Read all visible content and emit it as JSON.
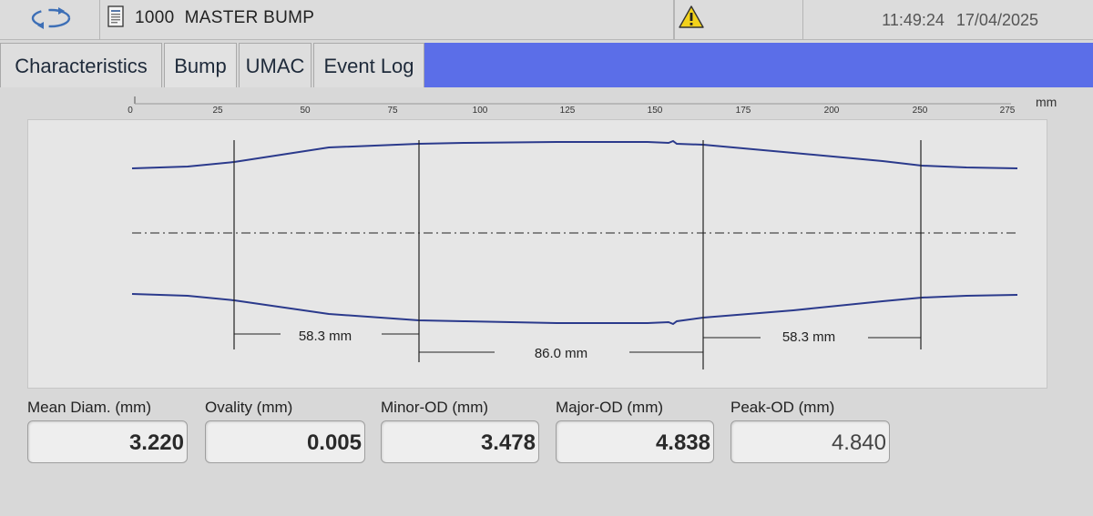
{
  "header": {
    "title": "1000  MASTER BUMP",
    "time": "11:49:24",
    "date": "17/04/2025",
    "icons": {
      "refresh": "refresh-icon",
      "document": "document-icon",
      "warning": "warning-icon"
    }
  },
  "tabs": [
    {
      "label": "Characteristics",
      "active": false
    },
    {
      "label": "Bump",
      "active": true
    },
    {
      "label": "UMAC",
      "active": false
    },
    {
      "label": "Event Log",
      "active": false
    }
  ],
  "ruler": {
    "unit": "mm",
    "ticks": [
      "0",
      "25",
      "50",
      "75",
      "100",
      "125",
      "150",
      "175",
      "200",
      "250",
      "275"
    ]
  },
  "profile": {
    "dimensions": [
      {
        "label": "58.3 mm"
      },
      {
        "label": "86.0 mm"
      },
      {
        "label": "58.3 mm"
      }
    ]
  },
  "readouts": [
    {
      "label": "Mean Diam. (mm)",
      "value": "3.220"
    },
    {
      "label": "Ovality (mm)",
      "value": "0.005"
    },
    {
      "label": "Minor-OD (mm)",
      "value": "3.478"
    },
    {
      "label": "Major-OD (mm)",
      "value": "4.838"
    },
    {
      "label": "Peak-OD (mm)",
      "value": "4.840"
    }
  ],
  "colors": {
    "accent": "#5b6ee8",
    "profile_line": "#2b3a8c",
    "warning": "#f2d21b"
  }
}
